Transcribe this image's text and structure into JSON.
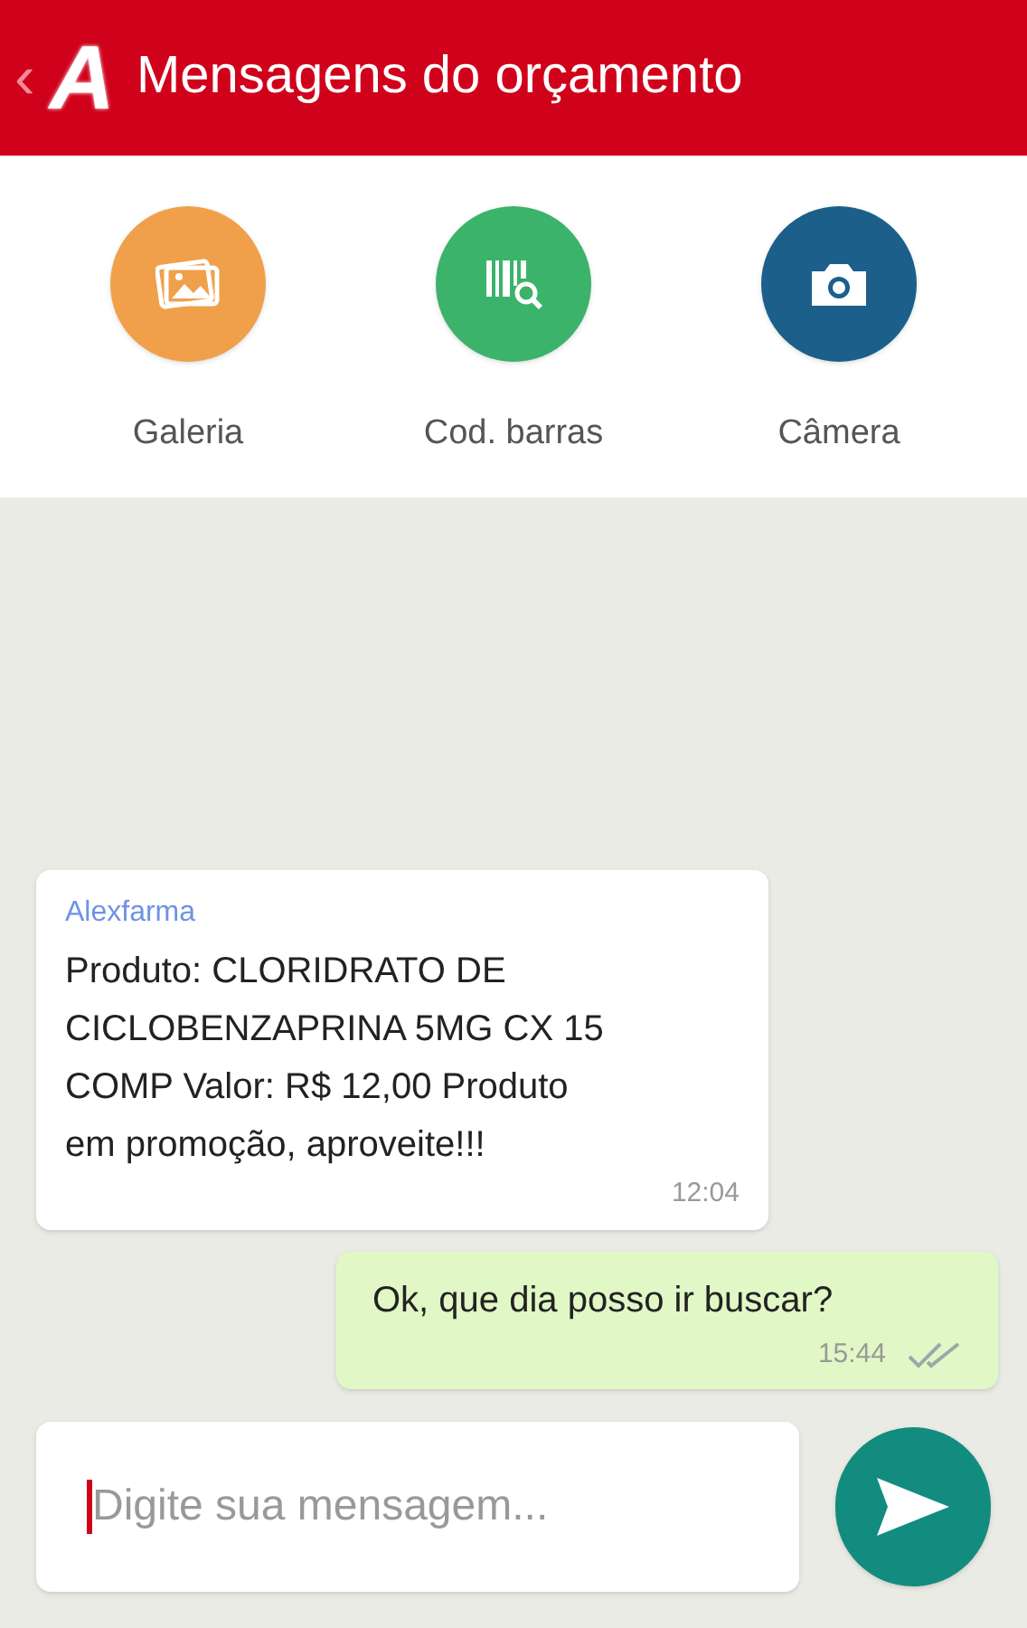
{
  "header": {
    "back": "‹",
    "logo": "A",
    "title": "Mensagens do orçamento"
  },
  "actions": [
    {
      "kind": "gallery",
      "label": "Galeria"
    },
    {
      "kind": "barcode",
      "label": "Cod. barras"
    },
    {
      "kind": "camera",
      "label": "Câmera"
    }
  ],
  "messages": [
    {
      "kind": "incoming",
      "sender": "Alexfarma",
      "text": "Produto: CLORIDRATO DE CICLOBENZAPRINA 5MG CX 15 COMP Valor: R$ 12,00 Produto em promoção, aproveite!!!",
      "time": "12:04"
    },
    {
      "kind": "outgoing",
      "text": "Ok, que dia posso ir buscar?",
      "time": "15:44",
      "read": true
    }
  ],
  "composer": {
    "placeholder": "Digite sua mensagem..."
  }
}
